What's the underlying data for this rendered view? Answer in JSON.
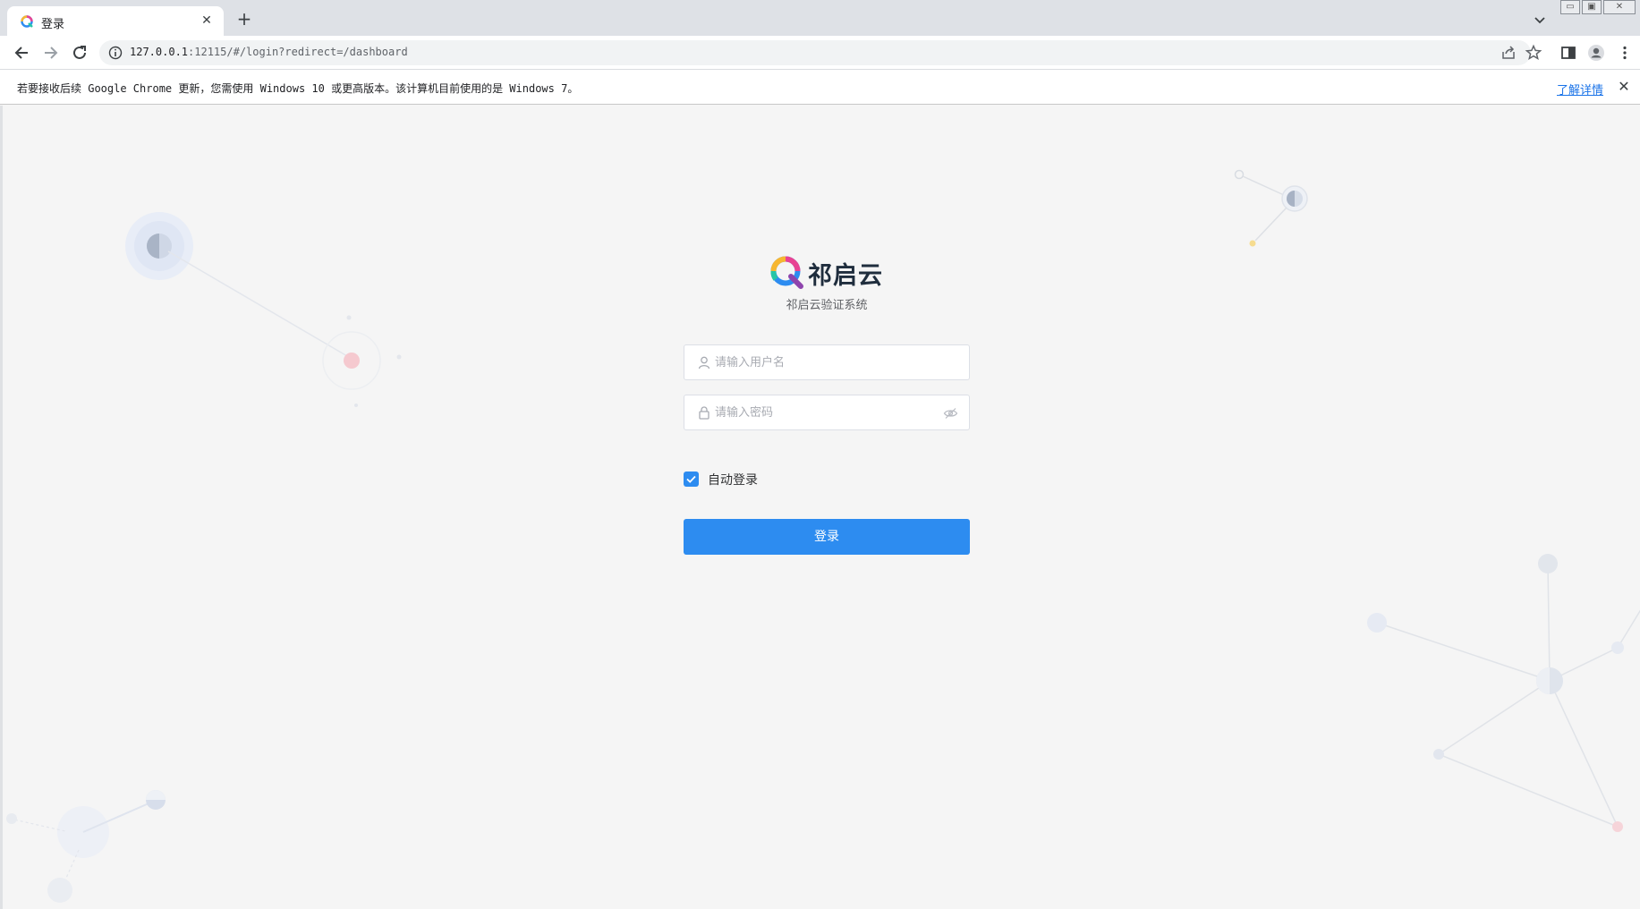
{
  "browser": {
    "tab_title": "登录",
    "tab_close": "✕",
    "new_tab": "+",
    "url_host": "127.0.0.1",
    "url_rest": ":12115/#/login?redirect=/dashboard",
    "window_controls": [
      "▭",
      "▣",
      "✕"
    ]
  },
  "infobar": {
    "message": "若要接收后续 Google Chrome 更新，您需使用 Windows 10 或更高版本。该计算机目前使用的是 Windows 7。",
    "link": "了解详情",
    "close": "✕"
  },
  "login": {
    "brand": "祁启云",
    "subtitle": "祁启云验证系统",
    "username_placeholder": "请输入用户名",
    "username_value": "",
    "password_placeholder": "请输入密码",
    "password_value": "",
    "remember_label": "自动登录",
    "remember_checked": true,
    "submit_label": "登录"
  },
  "colors": {
    "primary": "#2d8cf0",
    "page_bg": "#f5f5f5",
    "tabstrip_bg": "#dee1e6"
  },
  "icons": [
    "q-logo-icon",
    "close-icon",
    "plus-icon",
    "chevron-down-icon",
    "back-icon",
    "forward-icon",
    "reload-icon",
    "info-icon",
    "share-icon",
    "star-icon",
    "sidepanel-icon",
    "profile-icon",
    "menu-icon",
    "user-icon",
    "lock-icon",
    "eye-hidden-icon",
    "check-icon"
  ]
}
